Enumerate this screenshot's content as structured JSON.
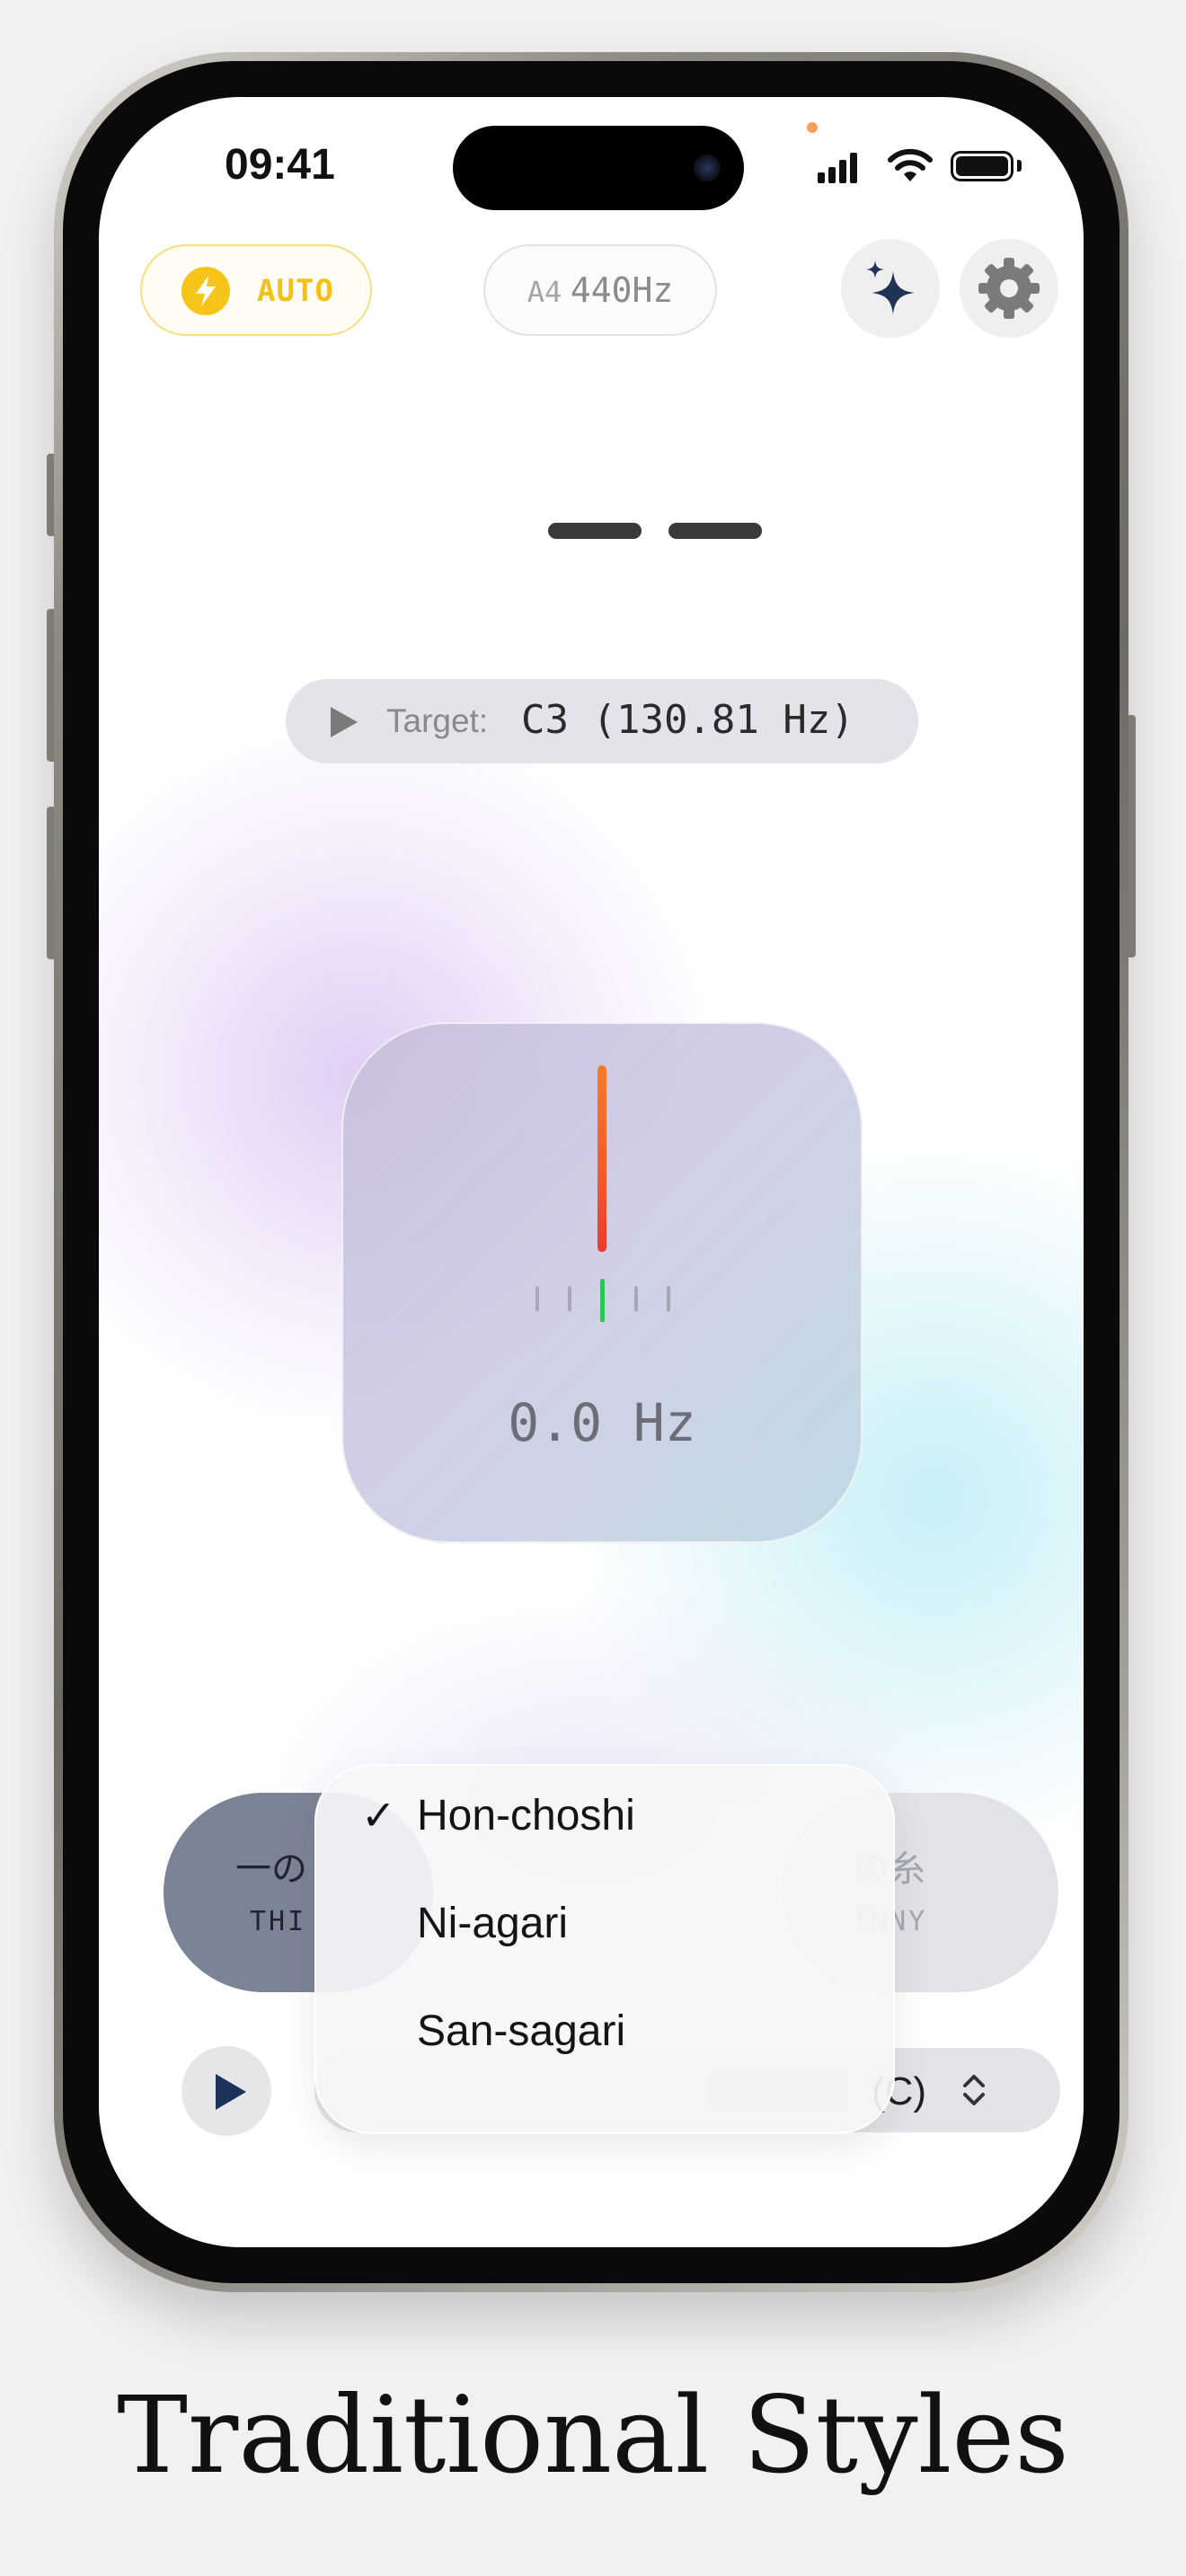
{
  "status_bar": {
    "time": "09:41"
  },
  "toolbar": {
    "auto_label": "AUTO",
    "reference_note": "A4",
    "reference_freq": "440Hz",
    "sparkle_icon": "sparkles-icon",
    "settings_icon": "gear-icon"
  },
  "note_display": {
    "placeholder": "— —"
  },
  "target": {
    "label": "Target:",
    "value": "C3 (130.81 Hz)"
  },
  "tuner": {
    "frequency": "0.0 Hz",
    "needle_color": "#f15a2a",
    "in_tune_color": "#2fc45a"
  },
  "strings": {
    "thick": {
      "jp": "一の",
      "en": "THI"
    },
    "thin": {
      "jp": "の糸",
      "en": "INNY"
    }
  },
  "tuning_selector": {
    "key_label": "(C)"
  },
  "menu": {
    "items": [
      {
        "label": "Hon-choshi",
        "selected": true,
        "check": "✓"
      },
      {
        "label": "Ni-agari",
        "selected": false
      },
      {
        "label": "San-sagari",
        "selected": false
      }
    ]
  },
  "caption": "Traditional Styles",
  "colors": {
    "accent_yellow": "#f7c51a",
    "play_navy": "#1d3259",
    "string_active": "#7b8495"
  }
}
